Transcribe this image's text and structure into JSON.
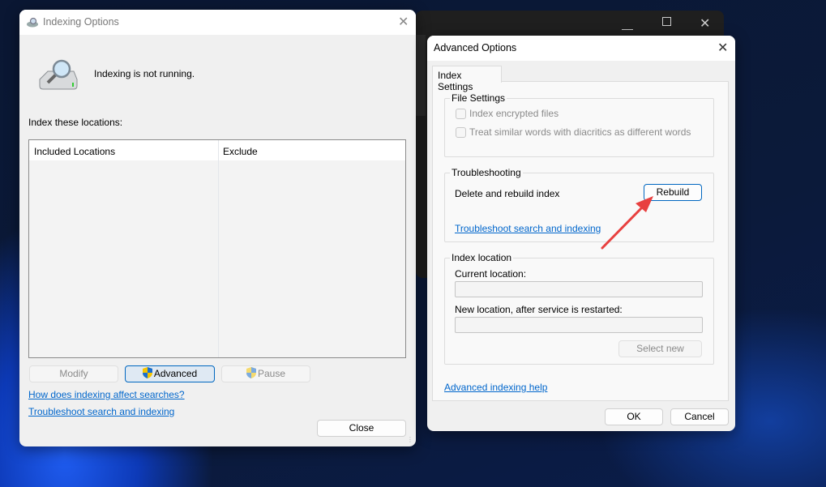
{
  "indexing_options": {
    "title": "Indexing Options",
    "status": "Indexing is not running.",
    "locations_label": "Index these locations:",
    "columns": [
      "Included Locations",
      "Exclude"
    ],
    "buttons": {
      "modify": "Modify",
      "advanced": "Advanced",
      "pause": "Pause",
      "close": "Close"
    },
    "links": [
      "How does indexing affect searches?",
      "Troubleshoot search and indexing"
    ]
  },
  "advanced_options": {
    "title": "Advanced Options",
    "tab": "Index Settings",
    "file_settings": {
      "title": "File Settings",
      "checkboxes": [
        {
          "label": "Index encrypted files",
          "checked": false
        },
        {
          "label": "Treat similar words with diacritics as different words",
          "checked": false
        }
      ]
    },
    "troubleshooting": {
      "title": "Troubleshooting",
      "rebuild_label": "Delete and rebuild index",
      "rebuild_button": "Rebuild",
      "link": "Troubleshoot search and indexing"
    },
    "index_location": {
      "title": "Index location",
      "current_label": "Current location:",
      "current_value": "",
      "new_label": "New location, after service is restarted:",
      "new_value": "",
      "select_new": "Select new"
    },
    "help_link": "Advanced indexing help",
    "ok": "OK",
    "cancel": "Cancel"
  },
  "colors": {
    "link": "#0066cc",
    "accent": "#0067c0",
    "annotation_arrow": "#e8403f"
  }
}
